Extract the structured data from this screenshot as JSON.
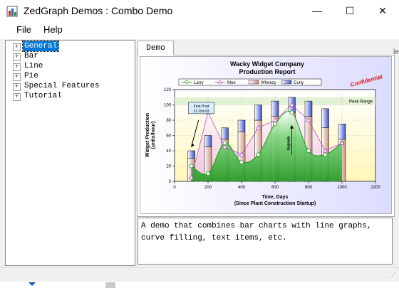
{
  "window": {
    "title": "ZedGraph Demos : Combo Demo",
    "min": "—",
    "max": "☐",
    "close": "✕"
  },
  "menu": [
    "File",
    "Help"
  ],
  "tree": [
    {
      "label": "General",
      "selected": true
    },
    {
      "label": "Bar"
    },
    {
      "label": "Line"
    },
    {
      "label": "Pie"
    },
    {
      "label": "Special Features"
    },
    {
      "label": "Tutorial"
    }
  ],
  "tab": {
    "label": "Demo"
  },
  "edge_glyph": "le",
  "description": "A demo that combines bar charts with line graphs, curve filling, text items, etc.",
  "chart_data": {
    "type": "bar",
    "title": "Wacky Widget Company",
    "subtitle": "Production Report",
    "ylabel": "Widget Production\n(units/hour)",
    "xlabel": "Time, Days",
    "xlabel2": "(Since Plant Construction Startup)",
    "xlim": [
      0,
      1200
    ],
    "ylim": [
      0,
      120
    ],
    "xticks": [
      0,
      200,
      400,
      600,
      800,
      1000,
      1200
    ],
    "yticks": [
      0,
      20,
      40,
      60,
      80,
      100,
      120
    ],
    "legend": [
      "Larry",
      "Moe",
      "Wheezy",
      "Curly"
    ],
    "x": [
      100,
      200,
      300,
      400,
      500,
      600,
      700,
      800,
      900,
      1000
    ],
    "series": [
      {
        "name": "Larry",
        "kind": "line-filled",
        "color": "#1a9a1a",
        "values": [
          20,
          10,
          50,
          25,
          35,
          75,
          90,
          40,
          35,
          50
        ]
      },
      {
        "name": "Moe",
        "kind": "line",
        "color": "#c050c0",
        "values": [
          5,
          90,
          45,
          35,
          70,
          80,
          100,
          80,
          40,
          50
        ]
      },
      {
        "name": "Wheezy",
        "kind": "bar-stack",
        "color": "#e8c8b8",
        "values": [
          30,
          45,
          55,
          65,
          80,
          85,
          90,
          85,
          70,
          55
        ]
      },
      {
        "name": "Curly",
        "kind": "bar-stack",
        "color": "#3a50c8",
        "values": [
          10,
          15,
          15,
          15,
          20,
          20,
          20,
          20,
          25,
          20
        ]
      }
    ],
    "annotations": {
      "confidential": "Confidential",
      "peak_range": "Peak Range",
      "first_prod": "First Prod\n21-Oct-93",
      "upgrade": "Upgrade"
    },
    "colors": {
      "chart_bg": "#fffdd8",
      "peak_band": "#e0f0d0",
      "outer_bg": "#ececff"
    }
  }
}
